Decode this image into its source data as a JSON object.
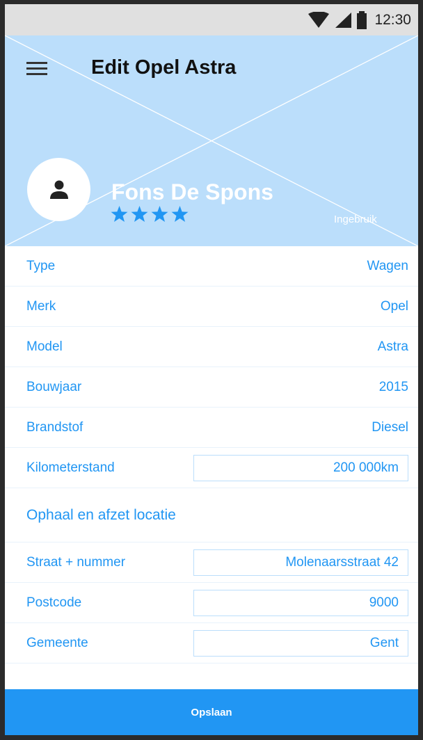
{
  "status_bar": {
    "time": "12:30",
    "icons": [
      "wifi-icon",
      "signal-icon",
      "battery-icon"
    ]
  },
  "header": {
    "title": "Edit Opel Astra",
    "menu_icon": "hamburger-menu-icon"
  },
  "profile": {
    "name": "Fons De Spons",
    "rating": 4,
    "rating_max": 4,
    "status": "Ingebruik",
    "avatar_icon": "person-icon"
  },
  "details": [
    {
      "label": "Type",
      "value": "Wagen"
    },
    {
      "label": "Merk",
      "value": "Opel"
    },
    {
      "label": "Model",
      "value": "Astra"
    },
    {
      "label": "Bouwjaar",
      "value": "2015"
    },
    {
      "label": "Brandstof",
      "value": "Diesel"
    }
  ],
  "mileage": {
    "label": "Kilometerstand",
    "value": "200 000km"
  },
  "location": {
    "heading": "Ophaal en afzet locatie",
    "street": {
      "label": "Straat + nummer",
      "value": "Molenaarsstraat 42"
    },
    "postcode": {
      "label": "Postcode",
      "value": "9000"
    },
    "city": {
      "label": "Gemeente",
      "value": "Gent"
    }
  },
  "save_button": {
    "label": "Opslaan"
  },
  "colors": {
    "accent": "#2196f3",
    "header_bg": "#bbdefb",
    "status_bar_bg": "#e0e0e0",
    "frame": "#2b2b2b"
  }
}
